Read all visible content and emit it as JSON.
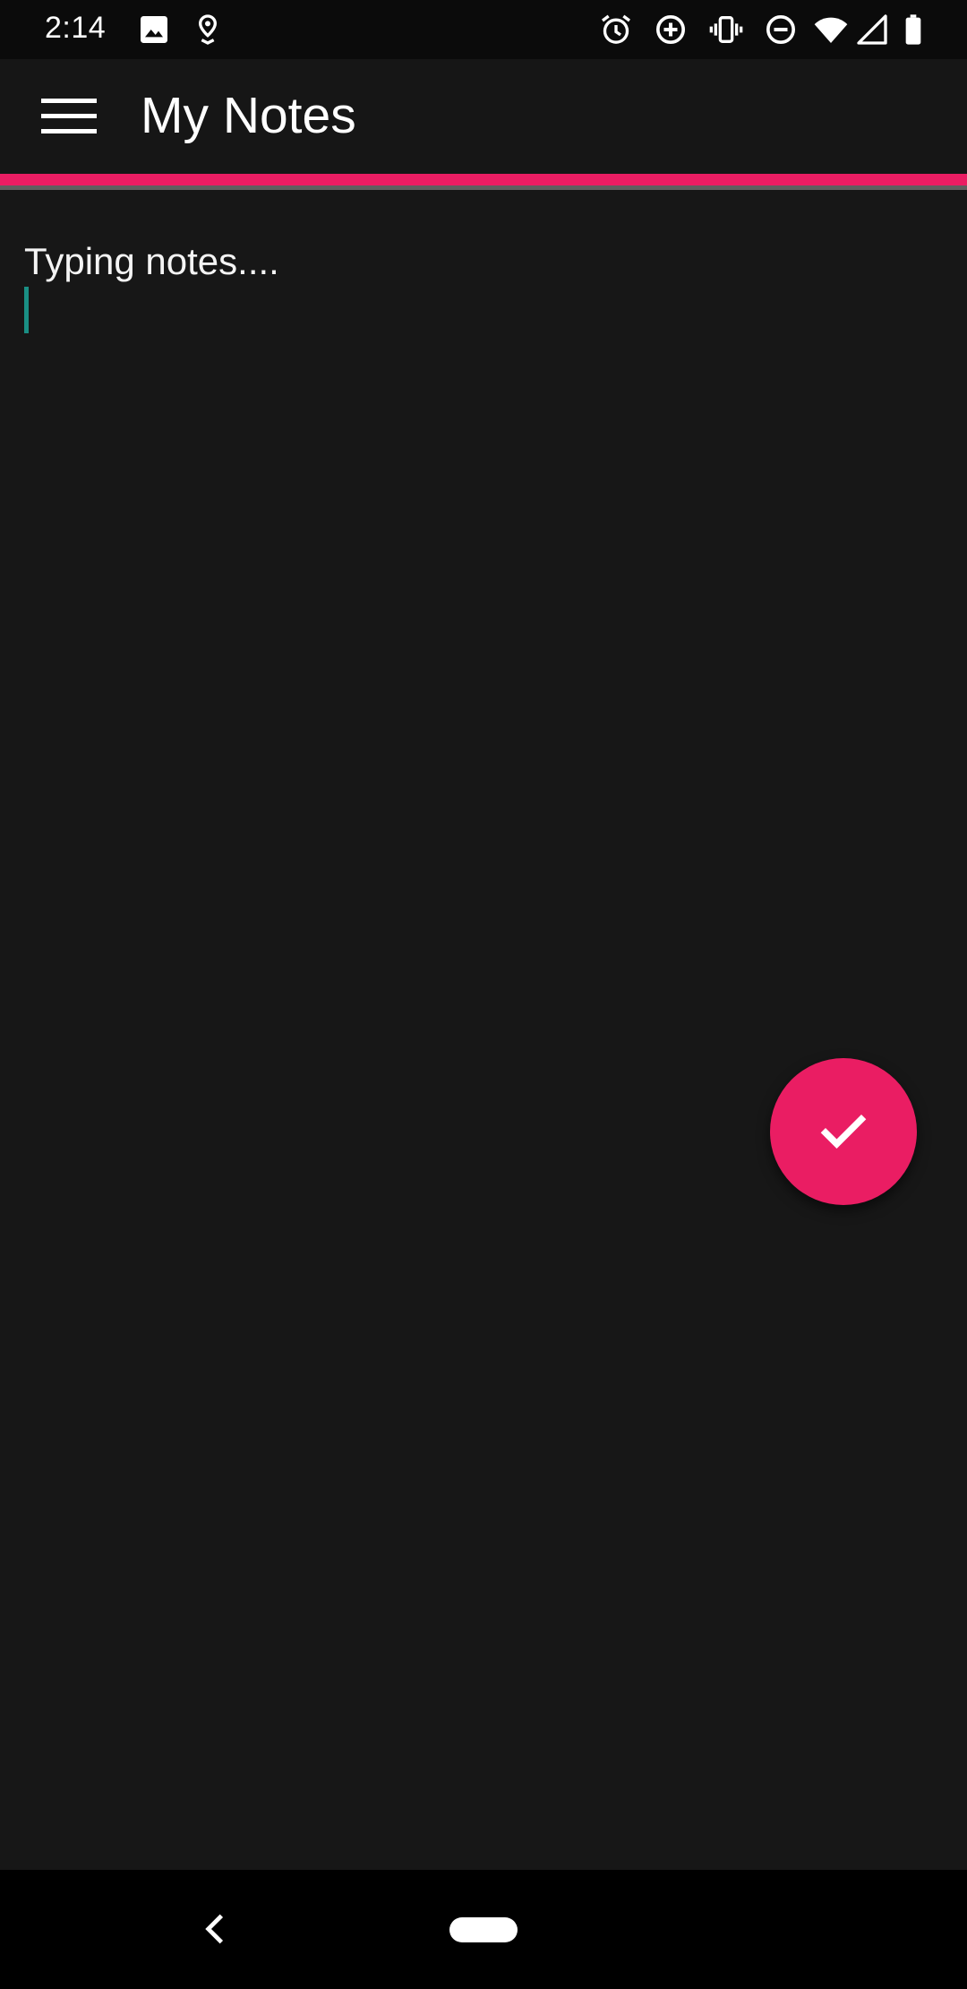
{
  "status_bar": {
    "time": "2:14",
    "left_icons": [
      "image-icon",
      "location-pin-icon"
    ],
    "right_icons": [
      "alarm-icon",
      "data-saver-icon",
      "vibrate-icon",
      "do-not-disturb-icon",
      "wifi-icon",
      "cell-signal-icon",
      "battery-icon"
    ]
  },
  "app_bar": {
    "title": "My Notes",
    "menu_icon": "hamburger-menu-icon"
  },
  "editor": {
    "text": "Typing notes...."
  },
  "fab": {
    "icon": "checkmark-icon"
  },
  "colors": {
    "accent": "#ea1d63",
    "background": "#171717",
    "cursor": "#1a8f84"
  },
  "nav_bar": {
    "icons": [
      "back-icon",
      "home-pill-icon"
    ]
  }
}
